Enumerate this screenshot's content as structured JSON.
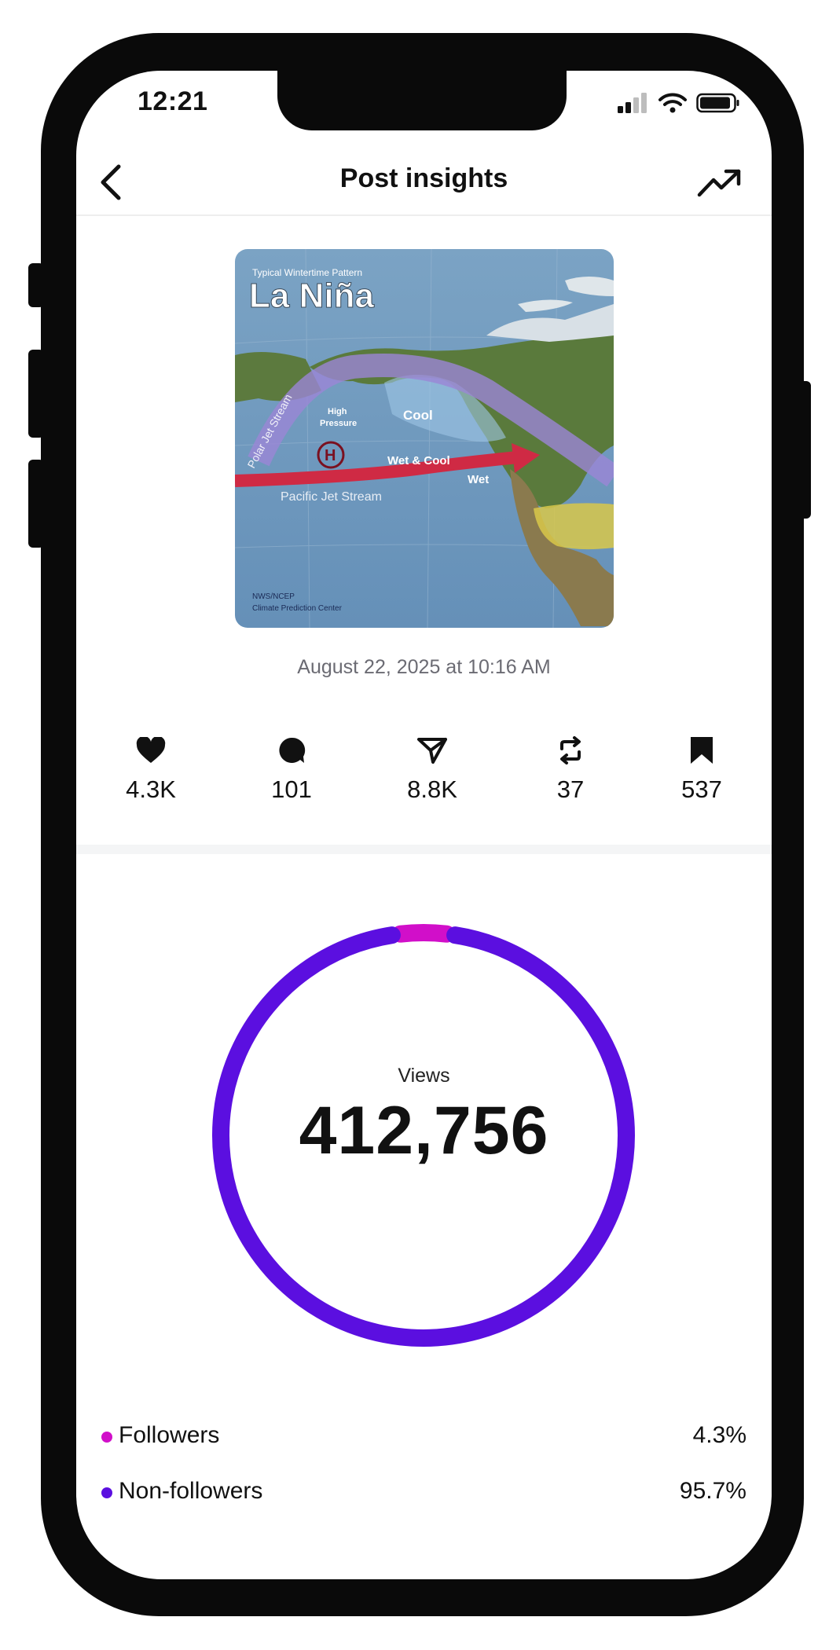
{
  "status_bar": {
    "time": "12:21"
  },
  "nav": {
    "title": "Post insights",
    "back_icon": "chevron-left-icon",
    "trend_icon": "trending-up-icon"
  },
  "post": {
    "image": {
      "subtitle": "Typical Wintertime Pattern",
      "title": "La Niña",
      "labels": {
        "polar_jet": "Polar Jet Stream",
        "high": "High",
        "pressure": "Pressure",
        "h": "H",
        "cool": "Cool",
        "wet_cool": "Wet & Cool",
        "wet": "Wet",
        "pacific_jet": "Pacific Jet Stream",
        "credit_1": "NWS/NCEP",
        "credit_2": "Climate Prediction Center"
      }
    },
    "date": "August 22, 2025 at 10:16 AM"
  },
  "stats": [
    {
      "icon": "heart-icon",
      "value": "4.3K"
    },
    {
      "icon": "comment-icon",
      "value": "101"
    },
    {
      "icon": "send-icon",
      "value": "8.8K"
    },
    {
      "icon": "repost-icon",
      "value": "37"
    },
    {
      "icon": "bookmark-icon",
      "value": "537"
    }
  ],
  "views": {
    "label": "Views",
    "value": "412,756",
    "chart_data": {
      "type": "pie",
      "segments": [
        {
          "name": "Followers",
          "value": 4.3,
          "color": "#d10fc9"
        },
        {
          "name": "Non-followers",
          "value": 95.7,
          "color": "#5b0fe0"
        }
      ]
    }
  },
  "legend": [
    {
      "name": "Followers",
      "pct": "4.3%",
      "color": "#d10fc9"
    },
    {
      "name": "Non-followers",
      "pct": "95.7%",
      "color": "#5b0fe0"
    }
  ]
}
